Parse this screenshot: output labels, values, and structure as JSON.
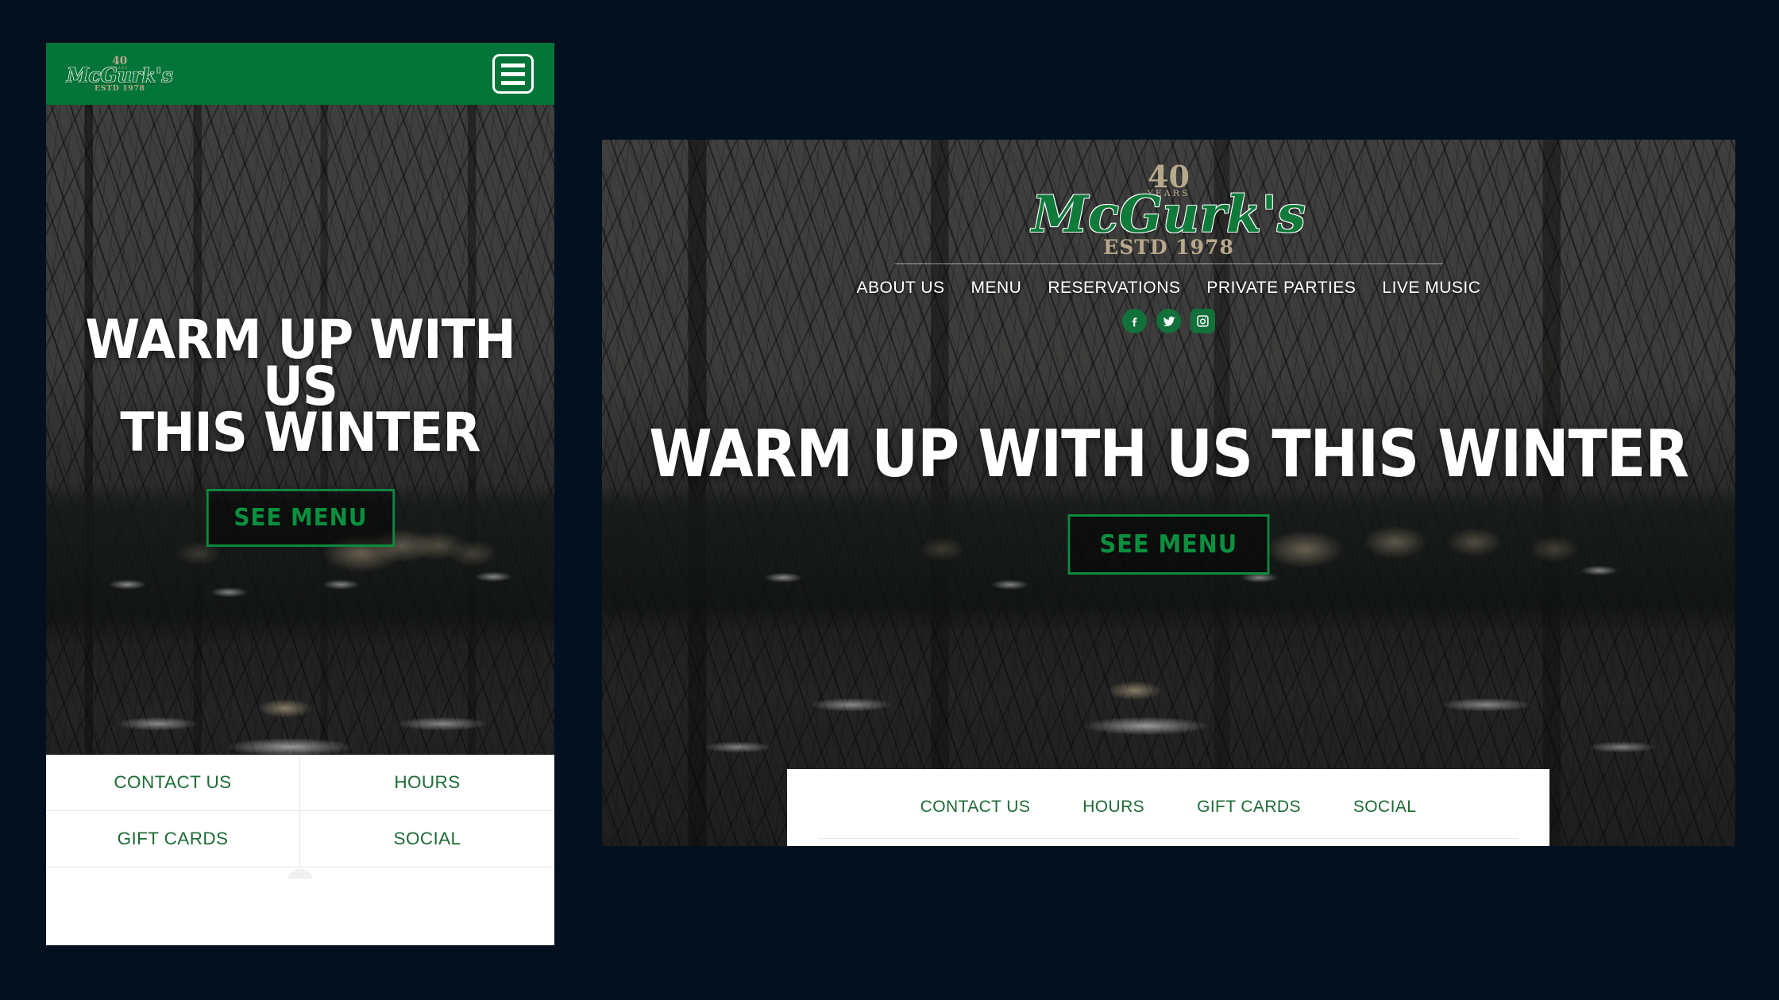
{
  "theme": {
    "page_background": "#03101f",
    "brand_green": "#037538",
    "link_green": "#1d6b36",
    "button_green": "#0b8f3f",
    "logo_gold": "#b9a98c",
    "white": "#ffffff"
  },
  "brand": {
    "anniversary_number": "40",
    "anniversary_unit": "YEARS",
    "name": "McGurk's",
    "established": "ESTD 1978"
  },
  "mobile": {
    "menu_icon": "hamburger-icon",
    "hero": {
      "headline": "WARM UP WITH US\nTHIS WINTER",
      "cta_label": "SEE MENU"
    },
    "quick_links": [
      {
        "label": "CONTACT US"
      },
      {
        "label": "HOURS"
      },
      {
        "label": "GIFT CARDS"
      },
      {
        "label": "SOCIAL"
      }
    ]
  },
  "desktop": {
    "nav": [
      {
        "label": "ABOUT US"
      },
      {
        "label": "MENU"
      },
      {
        "label": "RESERVATIONS"
      },
      {
        "label": "PRIVATE PARTIES"
      },
      {
        "label": "LIVE MUSIC"
      }
    ],
    "social": [
      {
        "name": "facebook-icon",
        "glyph": "f",
        "shape": "circle"
      },
      {
        "name": "twitter-icon",
        "glyph": "ᴠ",
        "shape": "circle"
      },
      {
        "name": "instagram-icon",
        "glyph": "◎",
        "shape": "square"
      }
    ],
    "hero": {
      "headline": "WARM UP WITH US THIS WINTER",
      "cta_label": "SEE MENU"
    },
    "quick_links": [
      {
        "label": "CONTACT US"
      },
      {
        "label": "HOURS"
      },
      {
        "label": "GIFT CARDS"
      },
      {
        "label": "SOCIAL"
      }
    ]
  }
}
